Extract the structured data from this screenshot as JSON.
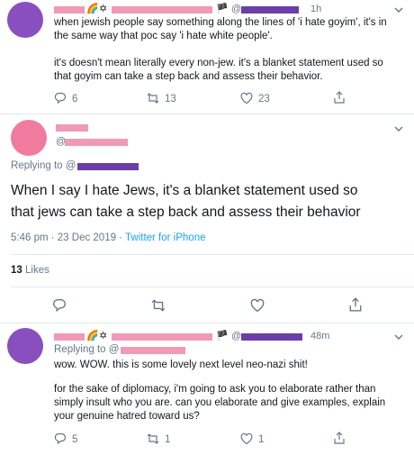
{
  "colors": {
    "avatar_purple": "#8a4fbf",
    "avatar_pink": "#f07b9f",
    "redact_pink": "#f09ab5",
    "redact_purple": "#6b3fa8",
    "muted": "#657786",
    "link": "#1da1f2"
  },
  "tweet1": {
    "timestamp": "1h",
    "at": "@",
    "emoji": [
      "🌈",
      "✡",
      "🏴"
    ],
    "text_line1": "when jewish people say something along the lines of 'i hate goyim', it's in",
    "text_line2": "the same way that poc say 'i hate white people'.",
    "text_line3": "it's doesn't mean literally every non-jew. it's a blanket statement used so",
    "text_line4": "that goyim can take a step back and assess their behavior.",
    "replies": "6",
    "retweets": "13",
    "likes": "23"
  },
  "tweet2": {
    "at": "@",
    "replying_to": "Replying to @",
    "text_line1": "When I say I hate Jews, it's a blanket statement used so",
    "text_line2": "that jews can take a step back and assess their behavior",
    "meta": "5:46 pm · 23 Dec 2019 · ",
    "source": "Twitter for iPhone",
    "likes_count": "13",
    "likes_label": "Likes"
  },
  "tweet3": {
    "timestamp": "48m",
    "at": "@",
    "emoji": [
      "🌈",
      "✡",
      "🏴"
    ],
    "replying_to": "Replying to @",
    "text_line1": "wow. WOW. this is some lovely next level neo-nazi shit!",
    "text_line2": "for the sake of diplomacy, i'm going to ask you to elaborate rather than",
    "text_line3": "simply insult who you are. can you elaborate and give examples, explain",
    "text_line4": "your genuine hatred toward us?",
    "replies": "5",
    "retweets": "1",
    "likes": "1"
  },
  "icons": {
    "reply": "reply-icon",
    "retweet": "retweet-icon",
    "like": "heart-icon",
    "share": "share-icon",
    "chevron": "chevron-down-icon"
  }
}
